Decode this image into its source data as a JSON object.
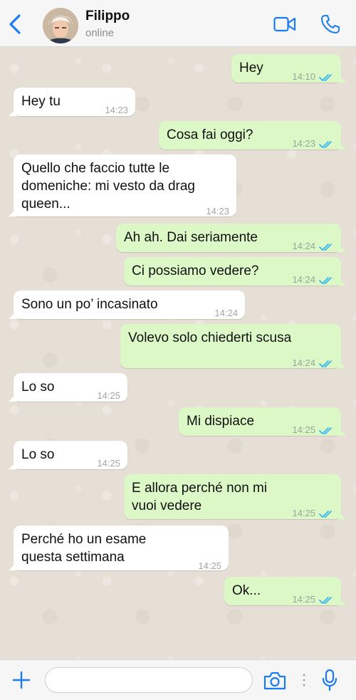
{
  "header": {
    "contact_name": "Filippo",
    "status": "online"
  },
  "icons": {
    "back": "chevron-left-icon",
    "video": "video-camera-icon",
    "call": "phone-icon",
    "plus": "plus-icon",
    "camera": "camera-icon",
    "mic": "microphone-icon"
  },
  "colors": {
    "accent": "#1a7bf2",
    "outgoing_bubble": "#dcf8c6",
    "incoming_bubble": "#ffffff",
    "chat_background": "#e6dfd5",
    "read_ticks": "#34b7f1"
  },
  "messages": [
    {
      "direction": "out",
      "text": "Hey",
      "time": "14:10",
      "read": true
    },
    {
      "direction": "in",
      "text": "Hey tu",
      "time": "14:23"
    },
    {
      "direction": "out",
      "text": "Cosa fai oggi?",
      "time": "14:23",
      "read": true
    },
    {
      "direction": "in",
      "text": "Quello che faccio tutte le\ndomeniche: mi vesto da drag\nqueen...",
      "time": "14:23"
    },
    {
      "direction": "out",
      "text": "Ah ah. Dai seriamente",
      "time": "14:24",
      "read": true
    },
    {
      "direction": "out",
      "text": "Ci possiamo vedere?",
      "time": "14:24",
      "read": true
    },
    {
      "direction": "in",
      "text": "Sono un po’ incasinato",
      "time": "14:24"
    },
    {
      "direction": "out",
      "text": "Volevo solo chiederti scusa",
      "time": "14:24",
      "read": true
    },
    {
      "direction": "in",
      "text": "Lo so",
      "time": "14:25"
    },
    {
      "direction": "out",
      "text": "Mi dispiace",
      "time": "14:25",
      "read": true
    },
    {
      "direction": "in",
      "text": "Lo so",
      "time": "14:25"
    },
    {
      "direction": "out",
      "text": "E allora perché non mi\nvuoi vedere",
      "time": "14:25",
      "read": true
    },
    {
      "direction": "in",
      "text": "Perché ho un esame\nquesta settimana",
      "time": "14:25"
    },
    {
      "direction": "out",
      "text": "Ok...",
      "time": "14:25",
      "read": true
    }
  ],
  "composer": {
    "placeholder": ""
  }
}
